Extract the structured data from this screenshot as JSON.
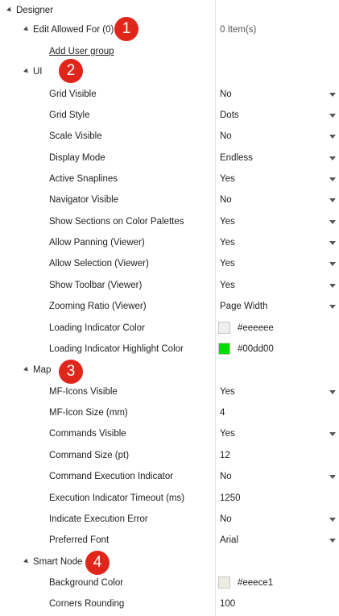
{
  "root": {
    "label": "Designer"
  },
  "edit_allowed": {
    "label": "Edit Allowed For (0)",
    "value": "0 Item(s)",
    "add_link": "Add User group"
  },
  "sections": {
    "ui": {
      "label": "UI"
    },
    "map": {
      "label": "Map"
    },
    "smart_node": {
      "label": "Smart Node"
    }
  },
  "ui": {
    "grid_visible": {
      "label": "Grid Visible",
      "value": "No"
    },
    "grid_style": {
      "label": "Grid Style",
      "value": "Dots"
    },
    "scale_visible": {
      "label": "Scale Visible",
      "value": "No"
    },
    "display_mode": {
      "label": "Display Mode",
      "value": "Endless"
    },
    "active_snaplines": {
      "label": "Active Snaplines",
      "value": "Yes"
    },
    "navigator_visible": {
      "label": "Navigator Visible",
      "value": "No"
    },
    "show_sections": {
      "label": "Show Sections on Color Palettes",
      "value": "Yes"
    },
    "allow_panning": {
      "label": "Allow Panning (Viewer)",
      "value": "Yes"
    },
    "allow_selection": {
      "label": "Allow Selection (Viewer)",
      "value": "Yes"
    },
    "show_toolbar": {
      "label": "Show Toolbar (Viewer)",
      "value": "Yes"
    },
    "zooming_ratio": {
      "label": "Zooming Ratio (Viewer)",
      "value": "Page Width"
    },
    "loading_color": {
      "label": "Loading Indicator Color",
      "value": "#eeeeee",
      "swatch": "#eeeeee"
    },
    "loading_highlight": {
      "label": "Loading Indicator Highlight Color",
      "value": "#00dd00",
      "swatch": "#00dd00"
    }
  },
  "map": {
    "mf_icons_visible": {
      "label": "MF-Icons Visible",
      "value": "Yes"
    },
    "mf_icon_size": {
      "label": "MF-Icon Size (mm)",
      "value": "4"
    },
    "commands_visible": {
      "label": "Commands Visible",
      "value": "Yes"
    },
    "command_size": {
      "label": "Command Size (pt)",
      "value": "12"
    },
    "command_exec_indicator": {
      "label": "Command Execution Indicator",
      "value": "No"
    },
    "exec_indicator_timeout": {
      "label": "Execution Indicator Timeout (ms)",
      "value": "1250"
    },
    "indicate_exec_error": {
      "label": "Indicate Execution Error",
      "value": "No"
    },
    "preferred_font": {
      "label": "Preferred Font",
      "value": "Arial"
    }
  },
  "smart_node": {
    "background_color": {
      "label": "Background Color",
      "value": "#eeece1",
      "swatch": "#eeece1"
    },
    "corners_rounding": {
      "label": "Corners Rounding",
      "value": "100"
    }
  },
  "badges": {
    "one": "1",
    "two": "2",
    "three": "3",
    "four": "4"
  },
  "colors": {
    "badge": "#e0261b",
    "divider": "#e3e3e3"
  }
}
